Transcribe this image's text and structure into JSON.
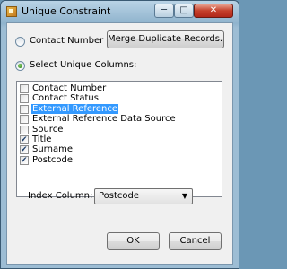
{
  "window": {
    "title": "Unique Constraint"
  },
  "caption_buttons": {
    "minimize": "─",
    "maximize": "□",
    "close": "✕"
  },
  "options": {
    "contact_number_label": "Contact Number",
    "merge_button_label": "Merge Duplicate Records...",
    "select_unique_label": "Select Unique Columns:"
  },
  "columns": [
    {
      "label": "Contact Number",
      "checked": false,
      "selected": false
    },
    {
      "label": "Contact Status",
      "checked": false,
      "selected": false
    },
    {
      "label": "External Reference",
      "checked": false,
      "selected": true
    },
    {
      "label": "External Reference Data Source",
      "checked": false,
      "selected": false
    },
    {
      "label": "Source",
      "checked": false,
      "selected": false
    },
    {
      "label": "Title",
      "checked": true,
      "selected": false
    },
    {
      "label": "Surname",
      "checked": true,
      "selected": false
    },
    {
      "label": "Postcode",
      "checked": true,
      "selected": false
    }
  ],
  "index_column": {
    "label": "Index Column:",
    "value": "Postcode"
  },
  "footer": {
    "ok_label": "OK",
    "cancel_label": "Cancel"
  },
  "icons": {
    "checkmark": "✔",
    "dropdown": "▼"
  }
}
